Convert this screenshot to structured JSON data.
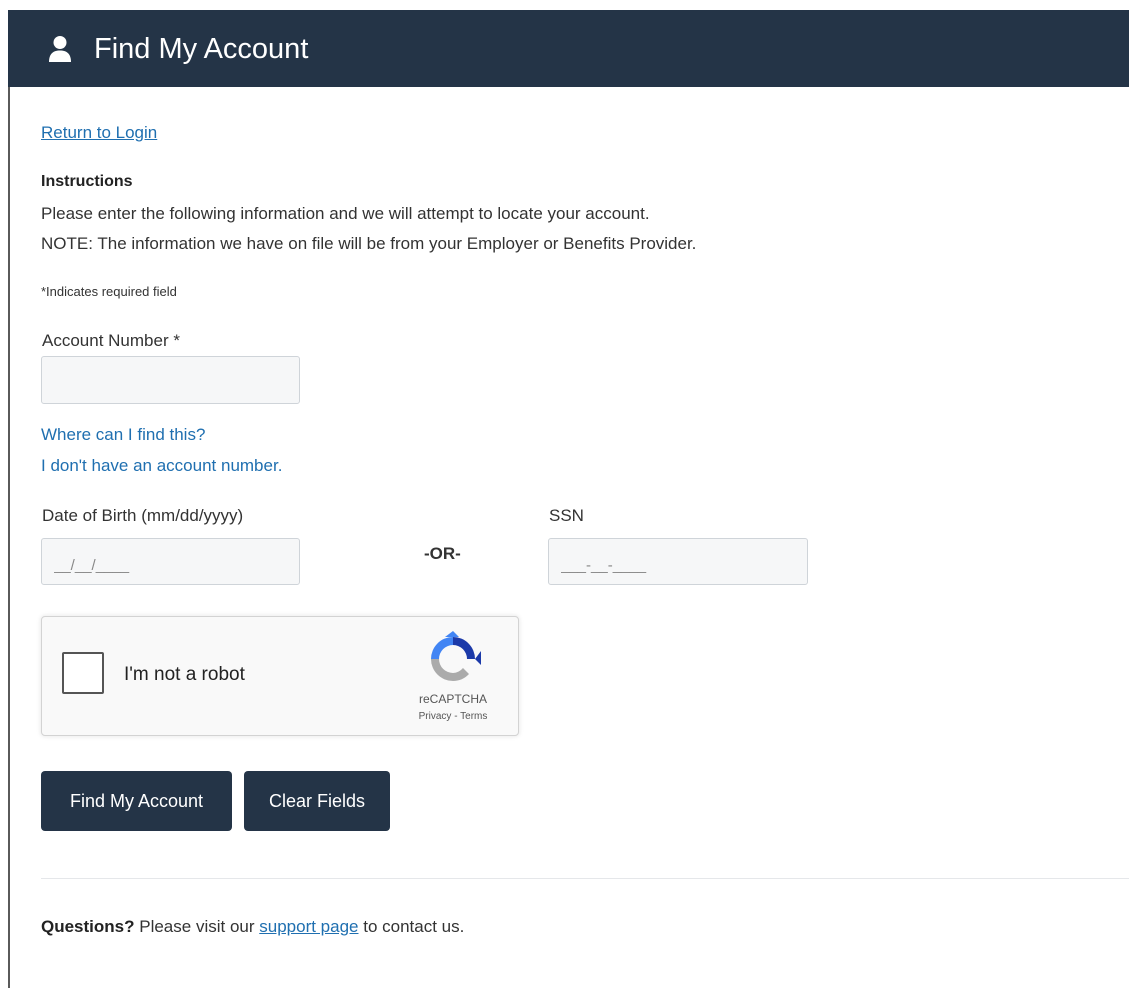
{
  "header": {
    "title": "Find My Account",
    "icon": "user-icon"
  },
  "nav": {
    "return_link": "Return to Login"
  },
  "instructions": {
    "title": "Instructions",
    "line1": "Please enter the following information and we will attempt to locate your account.",
    "line2": "NOTE: The information we have on file will be from your Employer or Benefits Provider.",
    "required_note": "*Indicates required field"
  },
  "form": {
    "account_number": {
      "label": "Account Number *",
      "value": "",
      "placeholder": ""
    },
    "help_links": {
      "where": "Where can I find this?",
      "no_account": "I don't have an account number."
    },
    "dob": {
      "label": "Date of Birth (mm/dd/yyyy)",
      "placeholder": "__/__/____"
    },
    "or_separator": "-OR-",
    "ssn": {
      "label": "SSN",
      "placeholder": "___-__-____"
    }
  },
  "recaptcha": {
    "label": "I'm not a robot",
    "brand": "reCAPTCHA",
    "terms": "Privacy - Terms",
    "checked": false
  },
  "buttons": {
    "find": "Find My Account",
    "clear": "Clear Fields"
  },
  "footer": {
    "questions": "Questions?",
    "text_before": " Please visit our ",
    "support_link": "support page",
    "text_after": " to contact us."
  },
  "colors": {
    "header_bg": "#243447",
    "button_bg": "#243447",
    "link": "#1f6fb0"
  }
}
